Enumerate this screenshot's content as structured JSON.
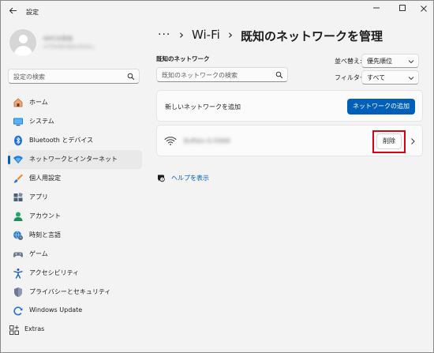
{
  "titlebar": {
    "back_icon": "arrow-left-icon",
    "title": "設定"
  },
  "profile": {
    "name": "NMCW家族",
    "email": "a7f30d8ed@outlook.jp"
  },
  "sidebar": {
    "search_placeholder": "設定の検索",
    "items": [
      {
        "label": "ホーム",
        "icon": "home-icon"
      },
      {
        "label": "システム",
        "icon": "monitor-icon"
      },
      {
        "label": "Bluetooth とデバイス",
        "icon": "bluetooth-icon"
      },
      {
        "label": "ネットワークとインターネット",
        "icon": "network-icon",
        "active": true
      },
      {
        "label": "個人用設定",
        "icon": "paintbrush-icon"
      },
      {
        "label": "アプリ",
        "icon": "apps-icon"
      },
      {
        "label": "アカウント",
        "icon": "person-icon"
      },
      {
        "label": "時刻と言語",
        "icon": "globe-clock-icon"
      },
      {
        "label": "ゲーム",
        "icon": "gamepad-icon"
      },
      {
        "label": "アクセシビリティ",
        "icon": "accessibility-icon"
      },
      {
        "label": "プライバシーとセキュリティ",
        "icon": "shield-icon"
      },
      {
        "label": "Windows Update",
        "icon": "update-icon"
      },
      {
        "label": "Extras",
        "icon": "extras-icon"
      }
    ]
  },
  "breadcrumb": {
    "more": "···",
    "sep": "›",
    "parent": "Wi-Fi",
    "current": "既知のネットワークを管理"
  },
  "known": {
    "label": "既知のネットワーク",
    "search_placeholder": "既知のネットワークの検索",
    "sort_label": "並べ替え:",
    "sort_value": "優先順位",
    "filter_label": "フィルター:",
    "filter_value": "すべて"
  },
  "add_network": {
    "text": "新しいネットワークを追加",
    "button": "ネットワークの追加"
  },
  "network": {
    "name": "Buffalo-G-D9A8",
    "forget_button": "削除"
  },
  "help": {
    "link": "ヘルプを表示"
  },
  "colors": {
    "accent": "#005fb8",
    "highlight": "#d9001b",
    "background": "#f3f3f3"
  }
}
